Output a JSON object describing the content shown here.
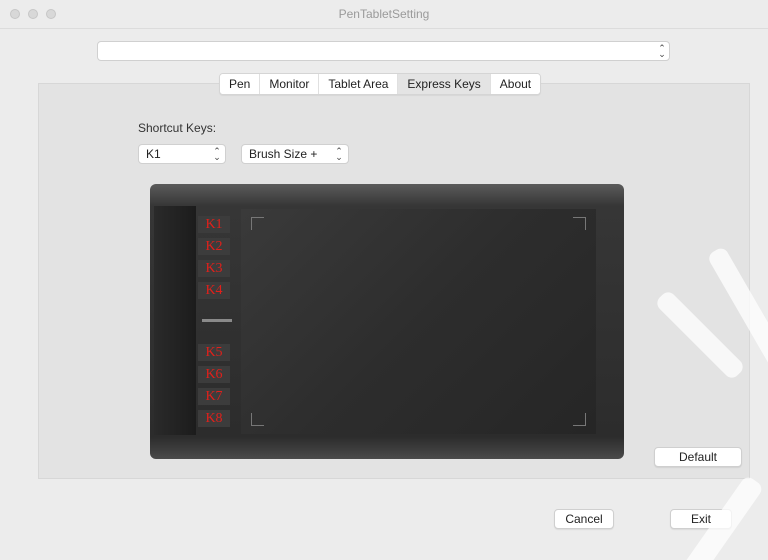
{
  "window": {
    "title": "PenTabletSetting"
  },
  "device_select": {
    "value": ""
  },
  "tabs": [
    {
      "label": "Pen",
      "active": false
    },
    {
      "label": "Monitor",
      "active": false
    },
    {
      "label": "Tablet Area",
      "active": false
    },
    {
      "label": "Express Keys",
      "active": true
    },
    {
      "label": "About",
      "active": false
    }
  ],
  "express_keys": {
    "label": "Shortcut Keys:",
    "key_select": {
      "value": "K1"
    },
    "action_select": {
      "value": "Brush Size +"
    },
    "keys": [
      "K1",
      "K2",
      "K3",
      "K4",
      "K5",
      "K6",
      "K7",
      "K8"
    ]
  },
  "buttons": {
    "default": "Default",
    "cancel": "Cancel",
    "exit": "Exit"
  },
  "colors": {
    "key_text": "#e0201b",
    "tablet_body": "#2c2c2c",
    "window_bg": "#ececec"
  }
}
